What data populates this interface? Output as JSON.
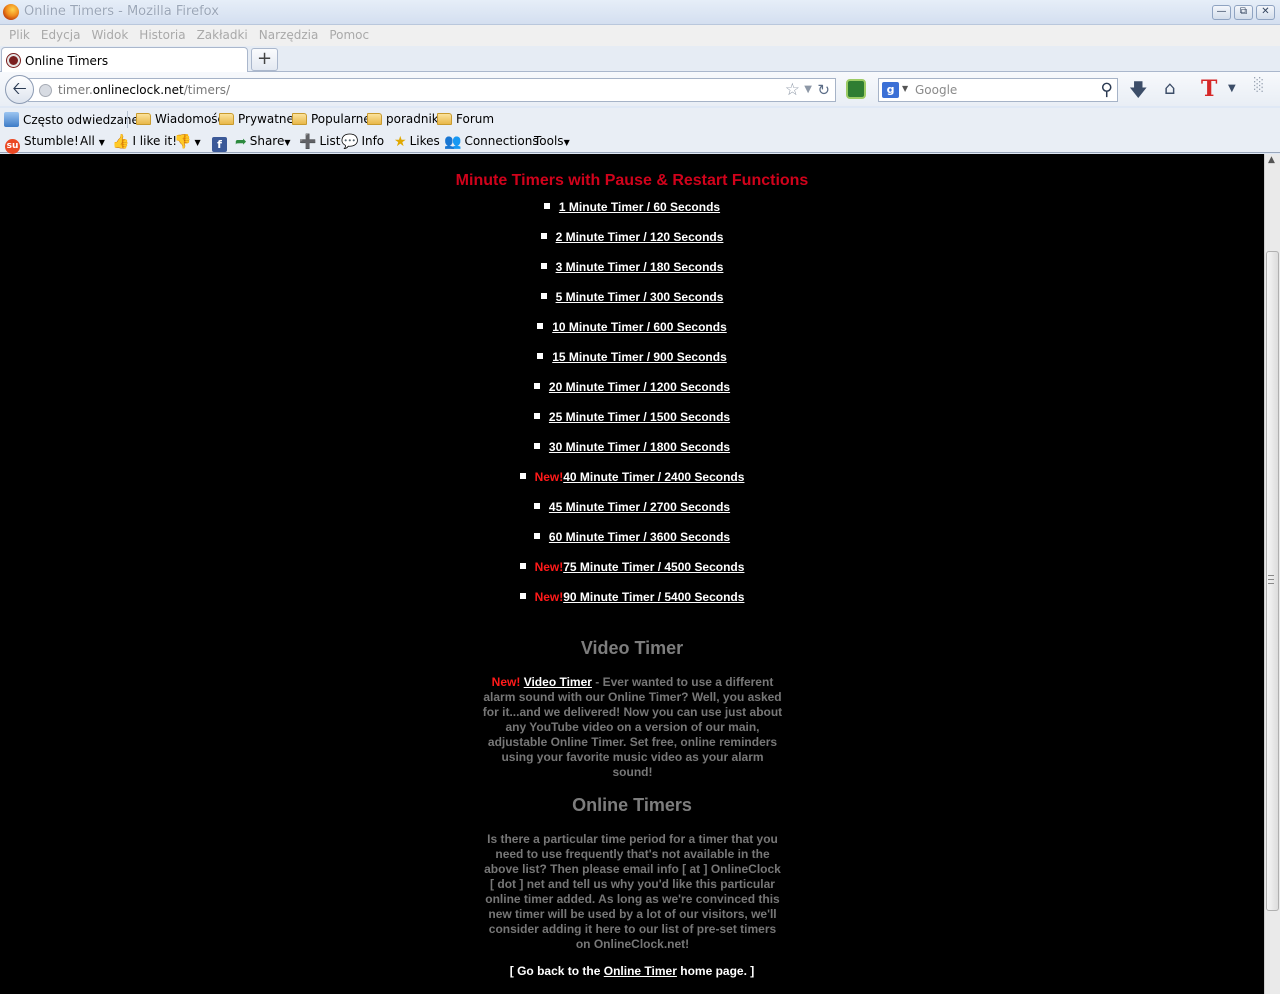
{
  "window": {
    "title": "Online Timers - Mozilla Firefox"
  },
  "menu": [
    "Plik",
    "Edycja",
    "Widok",
    "Historia",
    "Zakładki",
    "Narzędzia",
    "Pomoc"
  ],
  "tab": {
    "label": "Online Timers"
  },
  "url": {
    "prefix": "timer.",
    "domain": "onlineclock.net",
    "path": "/timers/"
  },
  "search": {
    "placeholder": "Google"
  },
  "bookmarks": [
    {
      "label": "Często odwiedzane",
      "icon": "most-visited-icon"
    },
    {
      "label": "Wiadomości",
      "icon": "folder-icon"
    },
    {
      "label": "Prywatne",
      "icon": "folder-icon"
    },
    {
      "label": "Popularne",
      "icon": "folder-icon"
    },
    {
      "label": "poradniki",
      "icon": "folder-icon"
    },
    {
      "label": "Forum",
      "icon": "folder-icon"
    }
  ],
  "stumble": {
    "stumble": "Stumble!",
    "all": "All",
    "like": "I like it!",
    "share": "Share",
    "list": "List",
    "info": "Info",
    "likes": "Likes",
    "connections": "Connections",
    "tools": "Tools"
  },
  "page": {
    "heading": "Minute Timers with Pause & Restart Functions",
    "new_label": "New!",
    "timers": [
      {
        "text": "1 Minute Timer / 60 Seconds",
        "isNew": false
      },
      {
        "text": "2 Minute Timer / 120 Seconds",
        "isNew": false
      },
      {
        "text": "3 Minute Timer / 180 Seconds",
        "isNew": false
      },
      {
        "text": "5 Minute Timer / 300 Seconds",
        "isNew": false
      },
      {
        "text": "10 Minute Timer / 600 Seconds",
        "isNew": false
      },
      {
        "text": "15 Minute Timer / 900 Seconds",
        "isNew": false
      },
      {
        "text": "20 Minute Timer / 1200 Seconds",
        "isNew": false
      },
      {
        "text": "25 Minute Timer / 1500 Seconds",
        "isNew": false
      },
      {
        "text": "30 Minute Timer / 1800 Seconds",
        "isNew": false
      },
      {
        "text": "40 Minute Timer / 2400 Seconds",
        "isNew": true
      },
      {
        "text": "45 Minute Timer / 2700 Seconds",
        "isNew": false
      },
      {
        "text": "60 Minute Timer / 3600 Seconds",
        "isNew": false
      },
      {
        "text": "75 Minute Timer / 4500 Seconds",
        "isNew": true
      },
      {
        "text": "90 Minute Timer / 5400 Seconds",
        "isNew": true
      }
    ],
    "video_title": "Video Timer",
    "video_new": "New!",
    "video_link": "Video Timer",
    "video_text": " - Ever wanted to use a different alarm sound with our Online Timer? Well, you asked for it...and we delivered! Now you can use just about any YouTube video on a version of our main, adjustable Online Timer. Set free, online reminders using your favorite music video as your alarm sound!",
    "online_title": "Online Timers",
    "online_text": "Is there a particular time period for a timer that you need to use frequently that's not available in the above list? Then please email info [ at ] OnlineClock [ dot ] net and tell us why you'd like this particular online timer added. As long as we're convinced this new timer will be used by a lot of our visitors, we'll consider adding it here to our list of pre-set timers on OnlineClock.net!",
    "back_prefix": "[ Go back to the ",
    "back_link": "Online Timer",
    "back_suffix": " home page. ]"
  }
}
